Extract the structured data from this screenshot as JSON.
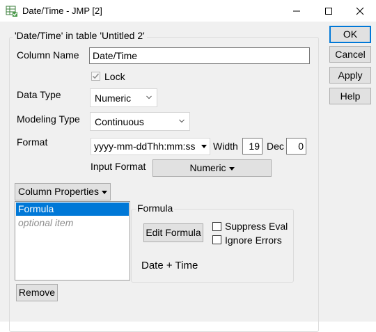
{
  "window": {
    "title": "Date/Time - JMP [2]",
    "minimize": "–",
    "maximize": "□",
    "close": "✕"
  },
  "group": {
    "title": "'Date/Time' in table 'Untitled 2'"
  },
  "column_name": {
    "label": "Column Name",
    "value": "Date/Time"
  },
  "lock": {
    "label": "Lock",
    "checked": true,
    "enabled": false
  },
  "data_type": {
    "label": "Data Type",
    "value": "Numeric"
  },
  "modeling_type": {
    "label": "Modeling Type",
    "value": "Continuous"
  },
  "format": {
    "label": "Format",
    "value": "yyyy-mm-ddThh:mm:ss",
    "width_label": "Width",
    "width_value": "19",
    "dec_label": "Dec",
    "dec_value": "0"
  },
  "input_format": {
    "label": "Input Format",
    "value": "Numeric"
  },
  "column_properties": {
    "button_label": "Column Properties",
    "items": [
      {
        "label": "Formula",
        "selected": true
      },
      {
        "label": "optional item",
        "selected": false
      }
    ],
    "remove_label": "Remove"
  },
  "formula_panel": {
    "title": "Formula",
    "edit_label": "Edit Formula",
    "suppress_eval": "Suppress Eval",
    "ignore_errors": "Ignore Errors",
    "expression": "Date + Time"
  },
  "buttons": {
    "ok": "OK",
    "cancel": "Cancel",
    "apply": "Apply",
    "help": "Help"
  },
  "colors": {
    "accent": "#0078d7",
    "dialog_bg": "#f0f0f0",
    "selection": "#0078d7"
  }
}
